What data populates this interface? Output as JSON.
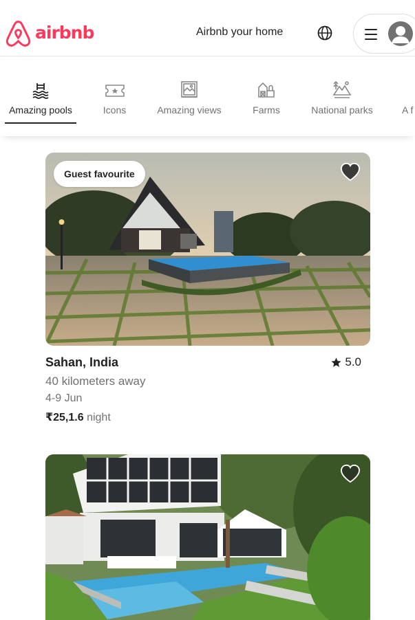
{
  "brand": {
    "name": "airbnb",
    "color": "#ff385c"
  },
  "header": {
    "host_link": "Airbnb your home",
    "globe_icon": "globe-icon",
    "menu_icon": "hamburger-icon",
    "avatar_icon": "user-avatar-icon"
  },
  "categories": [
    {
      "label": "Amazing pools",
      "icon": "pool-icon",
      "active": true
    },
    {
      "label": "Icons",
      "icon": "ticket-icon",
      "active": false
    },
    {
      "label": "Amazing views",
      "icon": "landscape-frame-icon",
      "active": false
    },
    {
      "label": "Farms",
      "icon": "barn-icon",
      "active": false
    },
    {
      "label": "National parks",
      "icon": "mountain-park-icon",
      "active": false
    },
    {
      "label": "A f",
      "icon": "",
      "active": false
    }
  ],
  "listings": [
    {
      "badge": "Guest favourite",
      "location": "Sahan, India",
      "rating": "5.0",
      "distance": "40 kilometers away",
      "dates": "4-9 Jun",
      "price": "₹25,1.6",
      "price_unit": "night",
      "image": "a-frame-house-with-pool-photo"
    },
    {
      "image": "modern-villa-with-pool-photo"
    }
  ]
}
